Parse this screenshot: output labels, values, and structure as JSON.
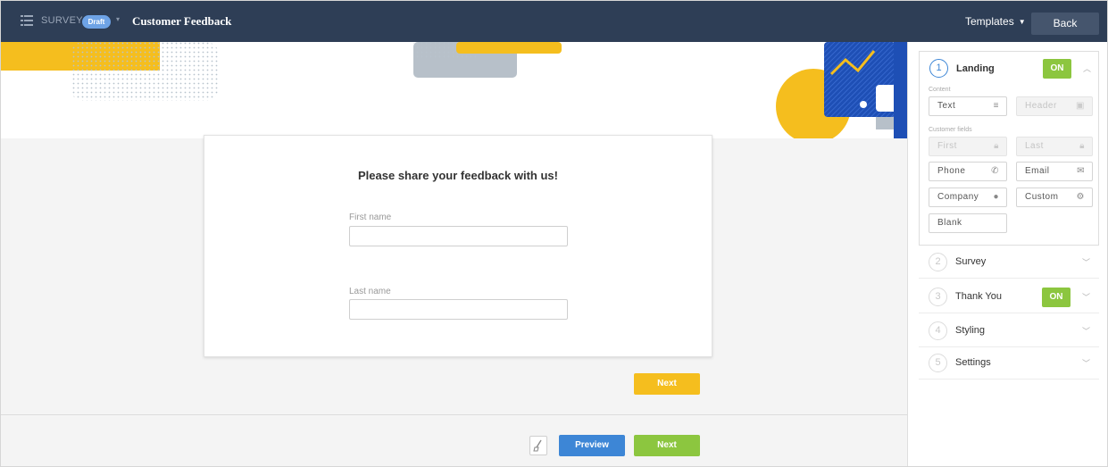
{
  "topbar": {
    "survey_label": "SURVEY",
    "status_badge": "Draft",
    "title": "Customer Feedback",
    "templates_label": "Templates",
    "back_label": "Back"
  },
  "card": {
    "heading": "Please share your feedback with us!",
    "first_name_label": "First name",
    "last_name_label": "Last name"
  },
  "actions": {
    "next_label": "Next",
    "preview_label": "Preview",
    "next_bottom_label": "Next"
  },
  "panel": {
    "landing": {
      "number": "1",
      "label": "Landing",
      "toggle": "ON",
      "content_label": "Content",
      "customer_fields_label": "Customer fields",
      "content_buttons": [
        {
          "label": "Text",
          "icon": "text-lines-icon",
          "disabled": false
        },
        {
          "label": "Header",
          "icon": "header-image-icon",
          "disabled": true
        }
      ],
      "field_buttons": [
        {
          "label": "First",
          "icon": "lock-icon",
          "disabled": true
        },
        {
          "label": "Last",
          "icon": "lock-icon",
          "disabled": true
        },
        {
          "label": "Phone",
          "icon": "phone-icon",
          "disabled": false
        },
        {
          "label": "Email",
          "icon": "envelope-icon",
          "disabled": false
        },
        {
          "label": "Company",
          "icon": "building-icon",
          "disabled": false
        },
        {
          "label": "Custom",
          "icon": "gear-icon",
          "disabled": false
        },
        {
          "label": "Blank",
          "icon": "",
          "disabled": false
        }
      ]
    },
    "steps": [
      {
        "number": "2",
        "label": "Survey",
        "toggle": ""
      },
      {
        "number": "3",
        "label": "Thank You",
        "toggle": "ON"
      },
      {
        "number": "4",
        "label": "Styling",
        "toggle": ""
      },
      {
        "number": "5",
        "label": "Settings",
        "toggle": ""
      }
    ]
  },
  "colors": {
    "topbar": "#2e3e56",
    "accent_blue": "#3d86d6",
    "accent_yellow": "#f5be1e",
    "accent_green": "#8cc63f"
  }
}
